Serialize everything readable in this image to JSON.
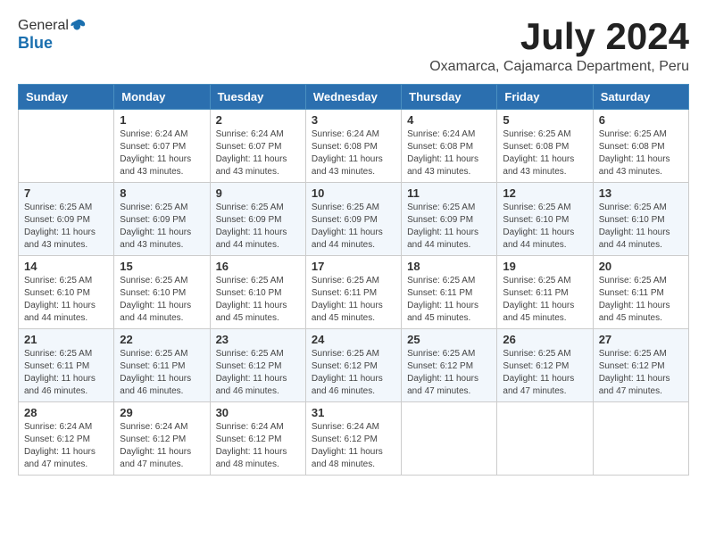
{
  "header": {
    "logo_general": "General",
    "logo_blue": "Blue",
    "month": "July 2024",
    "location": "Oxamarca, Cajamarca Department, Peru"
  },
  "days_of_week": [
    "Sunday",
    "Monday",
    "Tuesday",
    "Wednesday",
    "Thursday",
    "Friday",
    "Saturday"
  ],
  "weeks": [
    [
      {
        "day": "",
        "sunrise": "",
        "sunset": "",
        "daylight": ""
      },
      {
        "day": "1",
        "sunrise": "Sunrise: 6:24 AM",
        "sunset": "Sunset: 6:07 PM",
        "daylight": "Daylight: 11 hours and 43 minutes."
      },
      {
        "day": "2",
        "sunrise": "Sunrise: 6:24 AM",
        "sunset": "Sunset: 6:07 PM",
        "daylight": "Daylight: 11 hours and 43 minutes."
      },
      {
        "day": "3",
        "sunrise": "Sunrise: 6:24 AM",
        "sunset": "Sunset: 6:08 PM",
        "daylight": "Daylight: 11 hours and 43 minutes."
      },
      {
        "day": "4",
        "sunrise": "Sunrise: 6:24 AM",
        "sunset": "Sunset: 6:08 PM",
        "daylight": "Daylight: 11 hours and 43 minutes."
      },
      {
        "day": "5",
        "sunrise": "Sunrise: 6:25 AM",
        "sunset": "Sunset: 6:08 PM",
        "daylight": "Daylight: 11 hours and 43 minutes."
      },
      {
        "day": "6",
        "sunrise": "Sunrise: 6:25 AM",
        "sunset": "Sunset: 6:08 PM",
        "daylight": "Daylight: 11 hours and 43 minutes."
      }
    ],
    [
      {
        "day": "7",
        "sunrise": "Sunrise: 6:25 AM",
        "sunset": "Sunset: 6:09 PM",
        "daylight": "Daylight: 11 hours and 43 minutes."
      },
      {
        "day": "8",
        "sunrise": "Sunrise: 6:25 AM",
        "sunset": "Sunset: 6:09 PM",
        "daylight": "Daylight: 11 hours and 43 minutes."
      },
      {
        "day": "9",
        "sunrise": "Sunrise: 6:25 AM",
        "sunset": "Sunset: 6:09 PM",
        "daylight": "Daylight: 11 hours and 44 minutes."
      },
      {
        "day": "10",
        "sunrise": "Sunrise: 6:25 AM",
        "sunset": "Sunset: 6:09 PM",
        "daylight": "Daylight: 11 hours and 44 minutes."
      },
      {
        "day": "11",
        "sunrise": "Sunrise: 6:25 AM",
        "sunset": "Sunset: 6:09 PM",
        "daylight": "Daylight: 11 hours and 44 minutes."
      },
      {
        "day": "12",
        "sunrise": "Sunrise: 6:25 AM",
        "sunset": "Sunset: 6:10 PM",
        "daylight": "Daylight: 11 hours and 44 minutes."
      },
      {
        "day": "13",
        "sunrise": "Sunrise: 6:25 AM",
        "sunset": "Sunset: 6:10 PM",
        "daylight": "Daylight: 11 hours and 44 minutes."
      }
    ],
    [
      {
        "day": "14",
        "sunrise": "Sunrise: 6:25 AM",
        "sunset": "Sunset: 6:10 PM",
        "daylight": "Daylight: 11 hours and 44 minutes."
      },
      {
        "day": "15",
        "sunrise": "Sunrise: 6:25 AM",
        "sunset": "Sunset: 6:10 PM",
        "daylight": "Daylight: 11 hours and 44 minutes."
      },
      {
        "day": "16",
        "sunrise": "Sunrise: 6:25 AM",
        "sunset": "Sunset: 6:10 PM",
        "daylight": "Daylight: 11 hours and 45 minutes."
      },
      {
        "day": "17",
        "sunrise": "Sunrise: 6:25 AM",
        "sunset": "Sunset: 6:11 PM",
        "daylight": "Daylight: 11 hours and 45 minutes."
      },
      {
        "day": "18",
        "sunrise": "Sunrise: 6:25 AM",
        "sunset": "Sunset: 6:11 PM",
        "daylight": "Daylight: 11 hours and 45 minutes."
      },
      {
        "day": "19",
        "sunrise": "Sunrise: 6:25 AM",
        "sunset": "Sunset: 6:11 PM",
        "daylight": "Daylight: 11 hours and 45 minutes."
      },
      {
        "day": "20",
        "sunrise": "Sunrise: 6:25 AM",
        "sunset": "Sunset: 6:11 PM",
        "daylight": "Daylight: 11 hours and 45 minutes."
      }
    ],
    [
      {
        "day": "21",
        "sunrise": "Sunrise: 6:25 AM",
        "sunset": "Sunset: 6:11 PM",
        "daylight": "Daylight: 11 hours and 46 minutes."
      },
      {
        "day": "22",
        "sunrise": "Sunrise: 6:25 AM",
        "sunset": "Sunset: 6:11 PM",
        "daylight": "Daylight: 11 hours and 46 minutes."
      },
      {
        "day": "23",
        "sunrise": "Sunrise: 6:25 AM",
        "sunset": "Sunset: 6:12 PM",
        "daylight": "Daylight: 11 hours and 46 minutes."
      },
      {
        "day": "24",
        "sunrise": "Sunrise: 6:25 AM",
        "sunset": "Sunset: 6:12 PM",
        "daylight": "Daylight: 11 hours and 46 minutes."
      },
      {
        "day": "25",
        "sunrise": "Sunrise: 6:25 AM",
        "sunset": "Sunset: 6:12 PM",
        "daylight": "Daylight: 11 hours and 47 minutes."
      },
      {
        "day": "26",
        "sunrise": "Sunrise: 6:25 AM",
        "sunset": "Sunset: 6:12 PM",
        "daylight": "Daylight: 11 hours and 47 minutes."
      },
      {
        "day": "27",
        "sunrise": "Sunrise: 6:25 AM",
        "sunset": "Sunset: 6:12 PM",
        "daylight": "Daylight: 11 hours and 47 minutes."
      }
    ],
    [
      {
        "day": "28",
        "sunrise": "Sunrise: 6:24 AM",
        "sunset": "Sunset: 6:12 PM",
        "daylight": "Daylight: 11 hours and 47 minutes."
      },
      {
        "day": "29",
        "sunrise": "Sunrise: 6:24 AM",
        "sunset": "Sunset: 6:12 PM",
        "daylight": "Daylight: 11 hours and 47 minutes."
      },
      {
        "day": "30",
        "sunrise": "Sunrise: 6:24 AM",
        "sunset": "Sunset: 6:12 PM",
        "daylight": "Daylight: 11 hours and 48 minutes."
      },
      {
        "day": "31",
        "sunrise": "Sunrise: 6:24 AM",
        "sunset": "Sunset: 6:12 PM",
        "daylight": "Daylight: 11 hours and 48 minutes."
      },
      {
        "day": "",
        "sunrise": "",
        "sunset": "",
        "daylight": ""
      },
      {
        "day": "",
        "sunrise": "",
        "sunset": "",
        "daylight": ""
      },
      {
        "day": "",
        "sunrise": "",
        "sunset": "",
        "daylight": ""
      }
    ]
  ]
}
